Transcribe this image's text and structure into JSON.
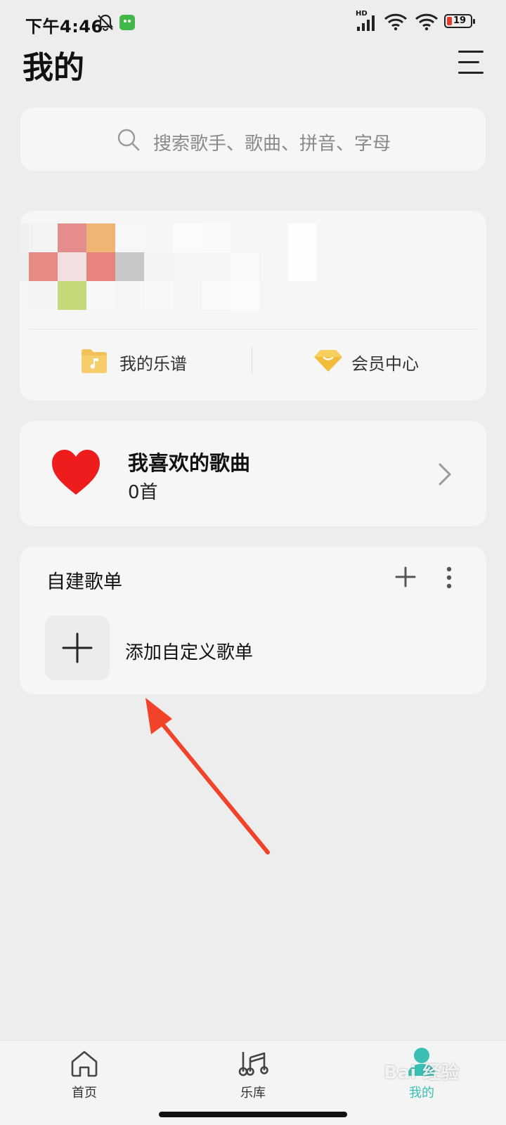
{
  "status_bar": {
    "time": "下午4:46",
    "network_label": "HD",
    "battery": "19"
  },
  "header": {
    "title": "我的"
  },
  "search": {
    "placeholder": "搜索歌手、歌曲、拼音、字母"
  },
  "profile": {
    "quick_links": [
      {
        "label": "我的乐谱",
        "icon": "music-folder-icon"
      },
      {
        "label": "会员中心",
        "icon": "gem-icon"
      }
    ]
  },
  "favorites": {
    "title": "我喜欢的歌曲",
    "count": "0首"
  },
  "playlists": {
    "section_title": "自建歌单",
    "add_label": "添加自定义歌单"
  },
  "bottom_nav": {
    "items": [
      {
        "label": "首页",
        "icon": "home-icon",
        "active": false
      },
      {
        "label": "乐库",
        "icon": "music-notes-icon",
        "active": false
      },
      {
        "label": "我的",
        "icon": "person-icon",
        "active": true
      }
    ]
  },
  "watermark": {
    "text": "Bai 经验"
  },
  "colors": {
    "background": "#ededed",
    "card": "#f6f6f6",
    "accent": "#3bbfb5",
    "heart": "#ee1c1c",
    "annotation_arrow": "#f0432a"
  }
}
